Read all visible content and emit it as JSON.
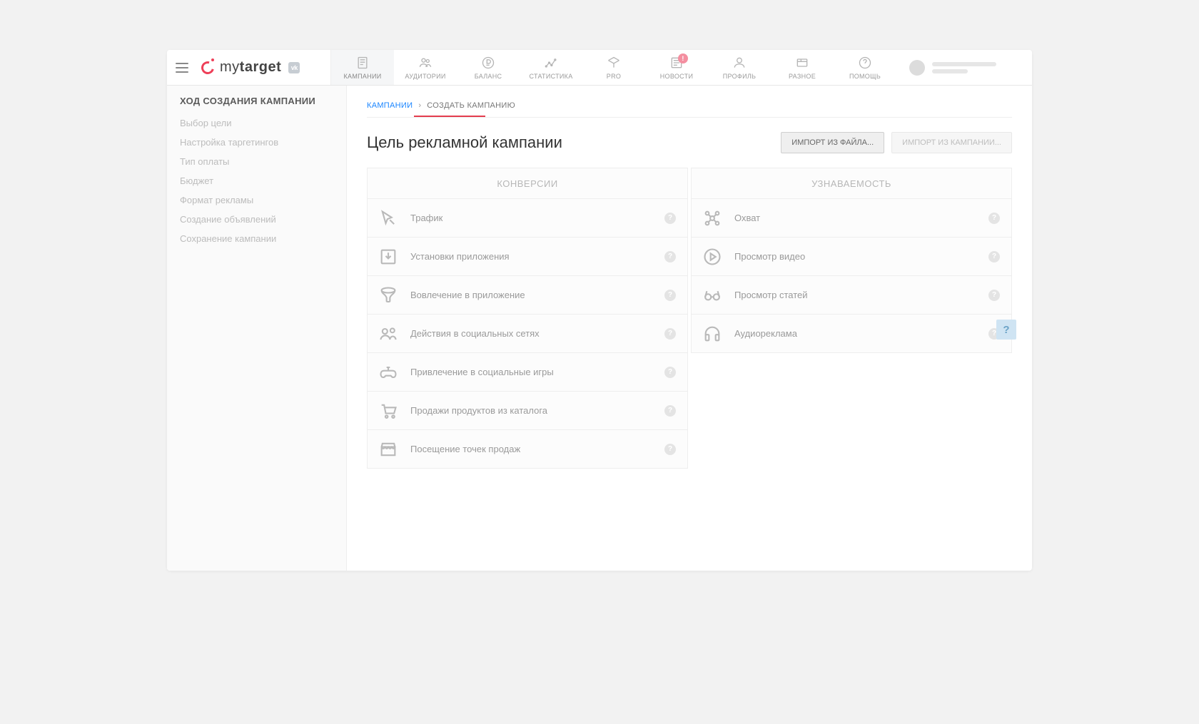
{
  "brand": {
    "name_part1": "my",
    "name_part2": "target",
    "vk_badge": "vk"
  },
  "topnav": [
    {
      "label": "КАМПАНИИ",
      "icon": "campaigns"
    },
    {
      "label": "АУДИТОРИИ",
      "icon": "audiences"
    },
    {
      "label": "БАЛАНС",
      "icon": "balance"
    },
    {
      "label": "СТАТИСТИКА",
      "icon": "stats"
    },
    {
      "label": "PRO",
      "icon": "pro"
    },
    {
      "label": "НОВОСТИ",
      "icon": "news",
      "badge": "!"
    },
    {
      "label": "ПРОФИЛЬ",
      "icon": "profile"
    },
    {
      "label": "РАЗНОЕ",
      "icon": "misc"
    },
    {
      "label": "ПОМОЩЬ",
      "icon": "help"
    }
  ],
  "sidebar": {
    "title": "ХОД СОЗДАНИЯ КАМПАНИИ",
    "steps": [
      "Выбор цели",
      "Настройка таргетингов",
      "Тип оплаты",
      "Бюджет",
      "Формат рекламы",
      "Создание объявлений",
      "Сохранение кампании"
    ]
  },
  "breadcrumb": {
    "root": "КАМПАНИИ",
    "sep": "›",
    "current": "СОЗДАТЬ КАМПАНИЮ"
  },
  "page_title": "Цель рекламной кампании",
  "buttons": {
    "import_file": "ИМПОРТ ИЗ ФАЙЛА...",
    "import_campaign": "ИМПОРТ ИЗ КАМПАНИИ..."
  },
  "columns": {
    "conversions": {
      "header": "КОНВЕРСИИ",
      "items": [
        {
          "label": "Трафик"
        },
        {
          "label": "Установки приложения"
        },
        {
          "label": "Вовлечение в приложение"
        },
        {
          "label": "Действия в социальных сетях"
        },
        {
          "label": "Привлечение в социальные игры"
        },
        {
          "label": "Продажи продуктов из каталога"
        },
        {
          "label": "Посещение точек продаж"
        }
      ]
    },
    "awareness": {
      "header": "УЗНАВАЕМОСТЬ",
      "items": [
        {
          "label": "Охват"
        },
        {
          "label": "Просмотр видео"
        },
        {
          "label": "Просмотр статей"
        },
        {
          "label": "Аудиореклама"
        }
      ]
    }
  },
  "hint_marker": "?",
  "floating_help": "?"
}
